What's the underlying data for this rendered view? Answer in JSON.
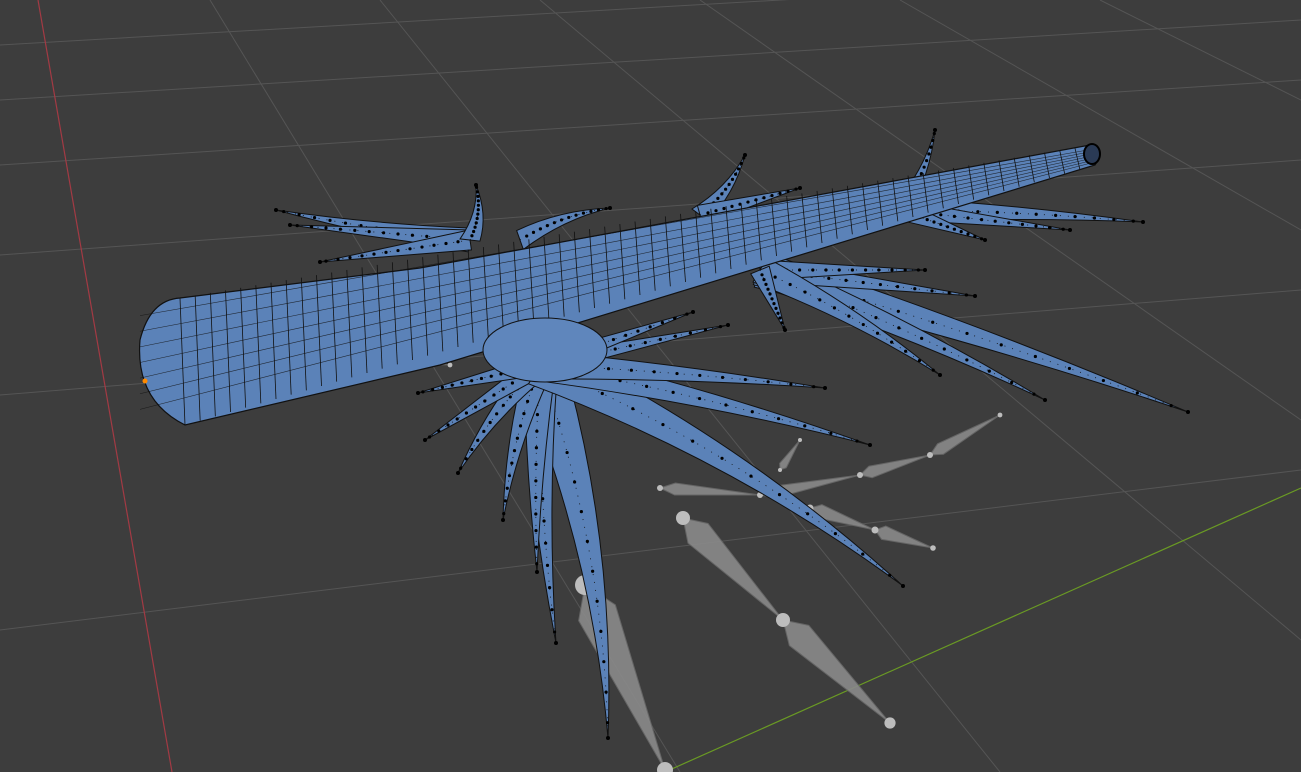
{
  "viewport": {
    "mode": "Edit Mode",
    "colors": {
      "background": "#3d3d3d",
      "grid": "#4f4f4f",
      "x_axis": "#a33a44",
      "y_axis": "#6a9a24",
      "mesh_face": "#5b82b8",
      "mesh_wire": "#111111",
      "bone": "#8c8c8c",
      "active_vertex": "#ff8a00"
    }
  }
}
